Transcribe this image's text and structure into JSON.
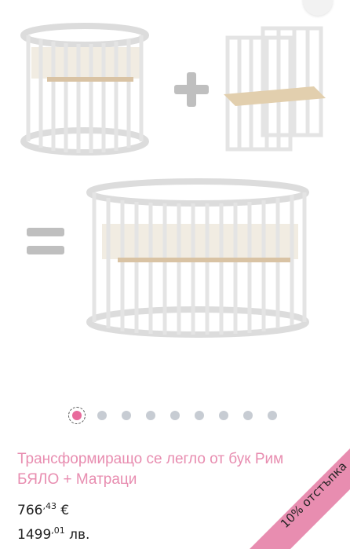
{
  "product": {
    "title": "Трансформиращо се легло от бук Рим БЯЛО + Матраци",
    "price_eur_main": "766",
    "price_eur_cents": ",43",
    "price_eur_currency": " €",
    "price_bgn_main": "1499",
    "price_bgn_cents": ",01",
    "price_bgn_currency": " лв."
  },
  "badge": {
    "discount": "10% отстъпка",
    "color": "#e88db0"
  },
  "gallery": {
    "total_images": 9,
    "active_index": 0,
    "active_color": "#e86a9c",
    "inactive_color": "#c7ccd3"
  },
  "icons": {
    "plus": "plus-sign",
    "equals": "equals-sign",
    "share": "share-icon"
  }
}
